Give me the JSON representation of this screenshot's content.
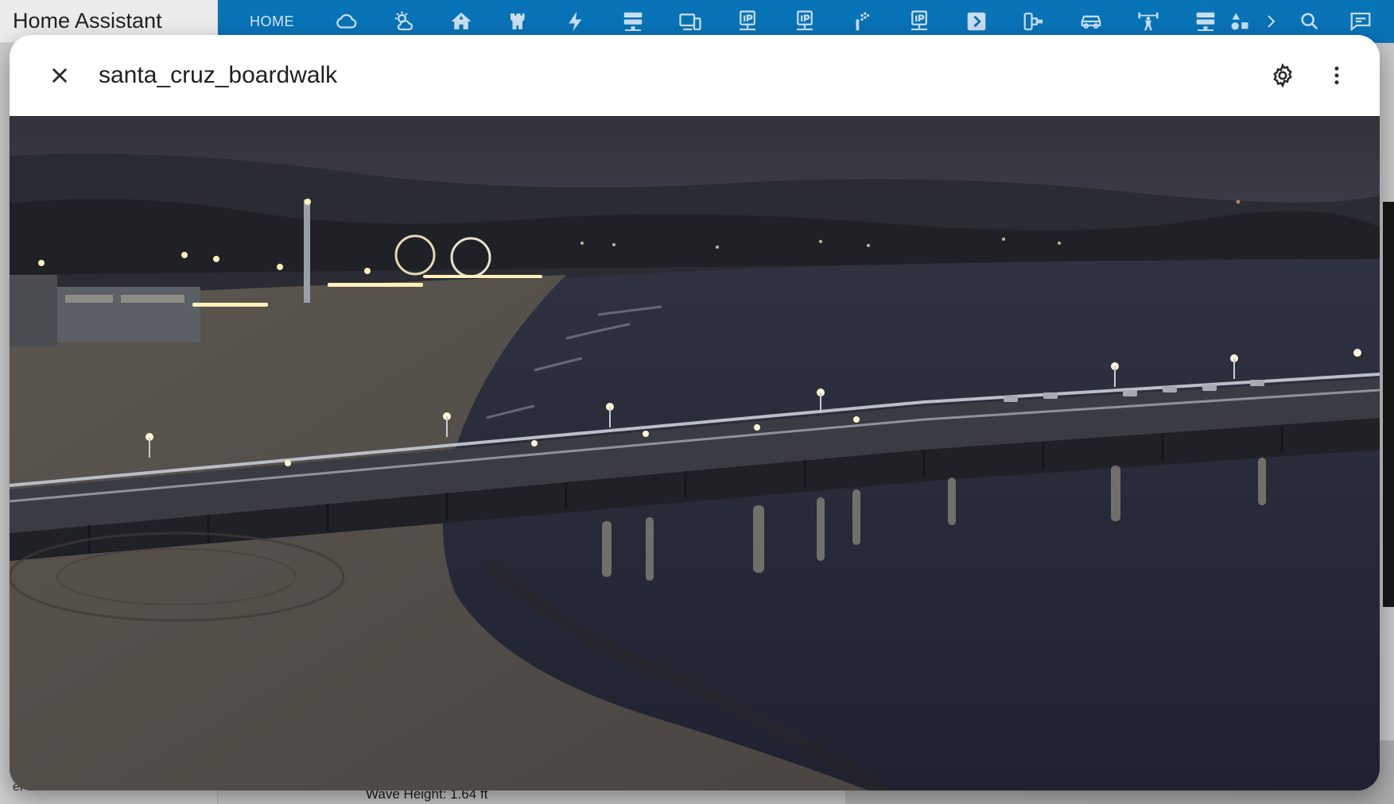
{
  "app": {
    "title": "Home Assistant",
    "footer_text": "er"
  },
  "topbar": {
    "home_tab": "HOME",
    "view_icons": [
      "cloud-icon",
      "weather-partly-cloudy-icon",
      "home-roof-icon",
      "castle-icon",
      "lightning-bolt-icon",
      "server-icon",
      "devices-icon",
      "ip-network-icon",
      "ip-network-icon-2",
      "sprinkler-icon",
      "ip-network-icon-3",
      "chevron-box-icon",
      "fuel-cell-icon",
      "car-icon",
      "weight-lifter-icon",
      "server-network-icon",
      "shape-icon"
    ],
    "more_views_icon": "chevron-right-icon",
    "search_icon": "search-icon",
    "assist_icon": "chat-icon"
  },
  "background": {
    "wave_height": "Wave Height: 1.64 ft"
  },
  "dialog": {
    "title": "santa_cruz_boardwalk",
    "close_icon": "close-icon",
    "settings_icon": "gear-icon",
    "menu_icon": "dots-vertical-icon"
  },
  "colors": {
    "header_blue": "#0973b8",
    "dialog_bg": "#ffffff",
    "icon_gray": "#4a4a4a"
  }
}
